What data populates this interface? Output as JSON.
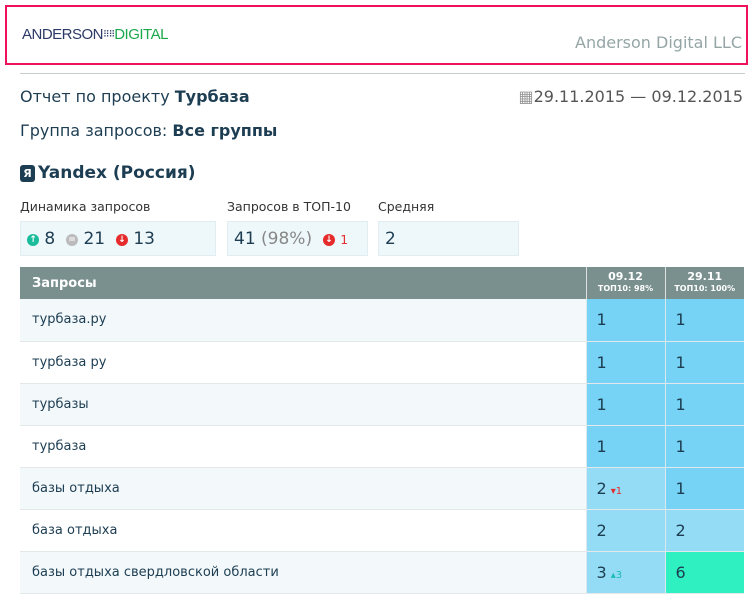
{
  "header": {
    "logo_left": "ANDERSON",
    "logo_right": "DIGITAL",
    "company": "Anderson Digital LLC"
  },
  "report": {
    "title_prefix": "Отчет по проекту",
    "project": "Турбаза",
    "date_range": "29.11.2015 — 09.12.2015",
    "group_prefix": "Группа запросов:",
    "group": "Все группы"
  },
  "engine": {
    "icon": "Я",
    "name": "Yandex (Россия)"
  },
  "stats": {
    "dynamics_label": "Динамика запросов",
    "up": "8",
    "same": "21",
    "down": "13",
    "top10_label": "Запросов в ТОП-10",
    "top10": "41",
    "top10_pct": "(98%)",
    "top10_change": "1",
    "avg_label": "Средняя",
    "avg": "2"
  },
  "table": {
    "header_query": "Запросы",
    "columns": [
      {
        "date": "09.12",
        "top": "ТОП10: 98%"
      },
      {
        "date": "29.11",
        "top": "ТОП10: 100%"
      }
    ],
    "rows": [
      {
        "q": "турбаза.ру",
        "a": "1",
        "b": "1",
        "ca": "c1",
        "cb": "c1",
        "chg": "",
        "dir": ""
      },
      {
        "q": "турбаза ру",
        "a": "1",
        "b": "1",
        "ca": "c1",
        "cb": "c1",
        "chg": "",
        "dir": ""
      },
      {
        "q": "турбазы",
        "a": "1",
        "b": "1",
        "ca": "c1",
        "cb": "c1",
        "chg": "",
        "dir": ""
      },
      {
        "q": "турбаза",
        "a": "1",
        "b": "1",
        "ca": "c1",
        "cb": "c1",
        "chg": "",
        "dir": ""
      },
      {
        "q": "базы отдыха",
        "a": "2",
        "b": "1",
        "ca": "c2",
        "cb": "c1",
        "chg": "1",
        "dir": "down"
      },
      {
        "q": "база отдыха",
        "a": "2",
        "b": "2",
        "ca": "c2",
        "cb": "c2",
        "chg": "",
        "dir": ""
      },
      {
        "q": "базы отдыха свердловской области",
        "a": "3",
        "b": "6",
        "ca": "c2",
        "cb": "c6",
        "chg": "3",
        "dir": "up"
      }
    ]
  }
}
